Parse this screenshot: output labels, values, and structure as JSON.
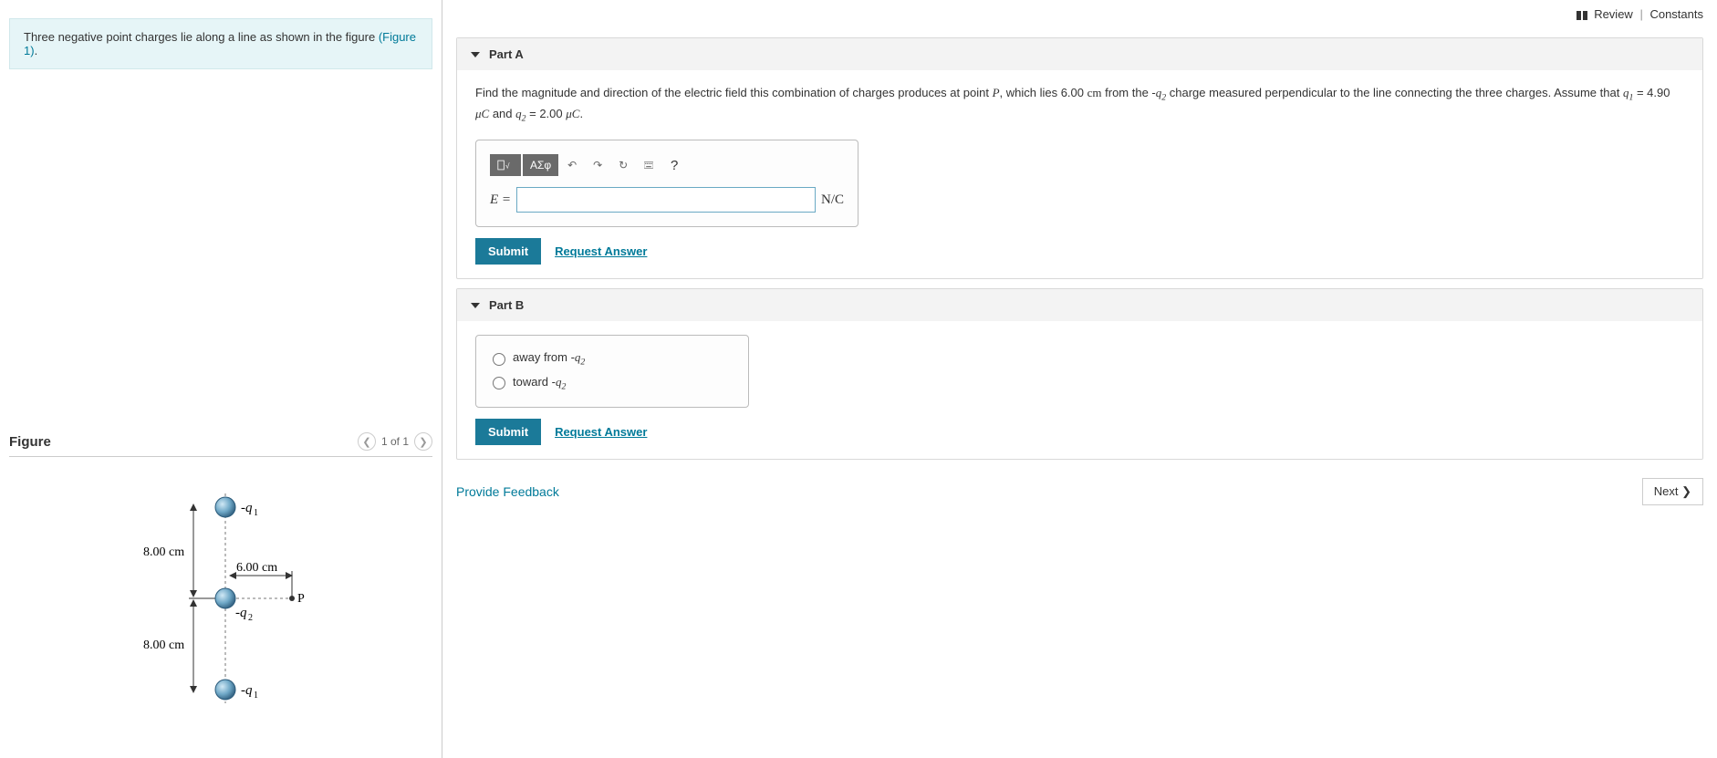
{
  "top": {
    "review": "Review",
    "constants": "Constants"
  },
  "intro": {
    "text": "Three negative point charges lie along a line as shown in the figure ",
    "fig_link": "(Figure 1)",
    "suffix": "."
  },
  "figure": {
    "title": "Figure",
    "counter": "1 of 1",
    "labels": {
      "q1_top": "-q₁",
      "q2": "-q₂",
      "q1_bot": "-q₁",
      "P": "P",
      "d_top": "8.00 cm",
      "d_bot": "8.00 cm",
      "d_horiz": "6.00 cm"
    }
  },
  "partA": {
    "title": "Part A",
    "question_pre": "Find the magnitude and direction of the electric field this combination of charges produces at point ",
    "question_P": "P",
    "question_mid1": ", which lies 6.00 ",
    "question_cm": "cm",
    "question_mid2": " from the -",
    "question_q2a": "q₂",
    "question_mid3": " charge measured perpendicular to the line connecting the three charges. Assume that ",
    "question_q1": "q₁",
    "question_val1": " = 4.90 ",
    "question_uC1": "μC",
    "question_and": " and ",
    "question_q2b": "q₂",
    "question_val2": " = 2.00 ",
    "question_uC2": "μC",
    "question_end": ".",
    "var": "E",
    "eq": " = ",
    "unit": "N/C",
    "tool_sigma": "ΑΣφ",
    "submit": "Submit",
    "request": "Request Answer",
    "help": "?"
  },
  "partB": {
    "title": "Part B",
    "option1_pre": "away from -",
    "option1_q": "q₂",
    "option2_pre": "toward -",
    "option2_q": "q₂",
    "submit": "Submit",
    "request": "Request Answer"
  },
  "footer": {
    "feedback": "Provide Feedback",
    "next": "Next ❯"
  }
}
